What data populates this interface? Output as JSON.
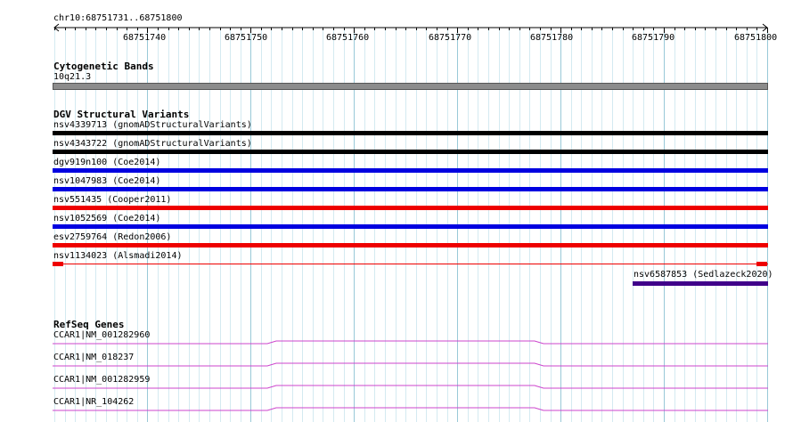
{
  "location": "chr10:68751731..68751800",
  "ruler": {
    "start": 68751731,
    "end": 68751800,
    "ticks": [
      "68751740",
      "68751750",
      "68751760",
      "68751770",
      "68751780",
      "68751790",
      "68751800"
    ]
  },
  "colors": {
    "grid_major": "#99c9d8",
    "grid_minor": "#d4eaf1",
    "band": "#8c8c8c",
    "gnomad": "#000000",
    "coe": "#0000e0",
    "cooper": "#ee0000",
    "sedlazeck": "#40008a",
    "gene": "#cc44cc"
  },
  "tracks": {
    "cytoband": {
      "title": "Cytogenetic Bands",
      "band_label": "10q21.3"
    },
    "dgv": {
      "title": "DGV Structural Variants",
      "variants": [
        {
          "label": "nsv4339713 (gnomADStructuralVariants)",
          "color": "#000000"
        },
        {
          "label": "nsv4343722 (gnomADStructuralVariants)",
          "color": "#000000"
        },
        {
          "label": "dgv919n100 (Coe2014)",
          "color": "#0000e0"
        },
        {
          "label": "nsv1047983 (Coe2014)",
          "color": "#0000e0"
        },
        {
          "label": "nsv551435 (Cooper2011)",
          "color": "#ee0000"
        },
        {
          "label": "nsv1052569 (Coe2014)",
          "color": "#0000e0"
        },
        {
          "label": "esv2759764 (Redon2006)",
          "color": "#ee0000"
        },
        {
          "label": "nsv1134023 (Alsmadi2014)",
          "color": "#ee0000"
        },
        {
          "label": "nsv6587853 (Sedlazeck2020)",
          "color": "#40008a"
        }
      ]
    },
    "refseq": {
      "title": "RefSeq Genes",
      "genes": [
        {
          "label": "CCAR1|NM_001282960"
        },
        {
          "label": "CCAR1|NM_018237"
        },
        {
          "label": "CCAR1|NM_001282959"
        },
        {
          "label": "CCAR1|NR_104262"
        }
      ]
    }
  }
}
